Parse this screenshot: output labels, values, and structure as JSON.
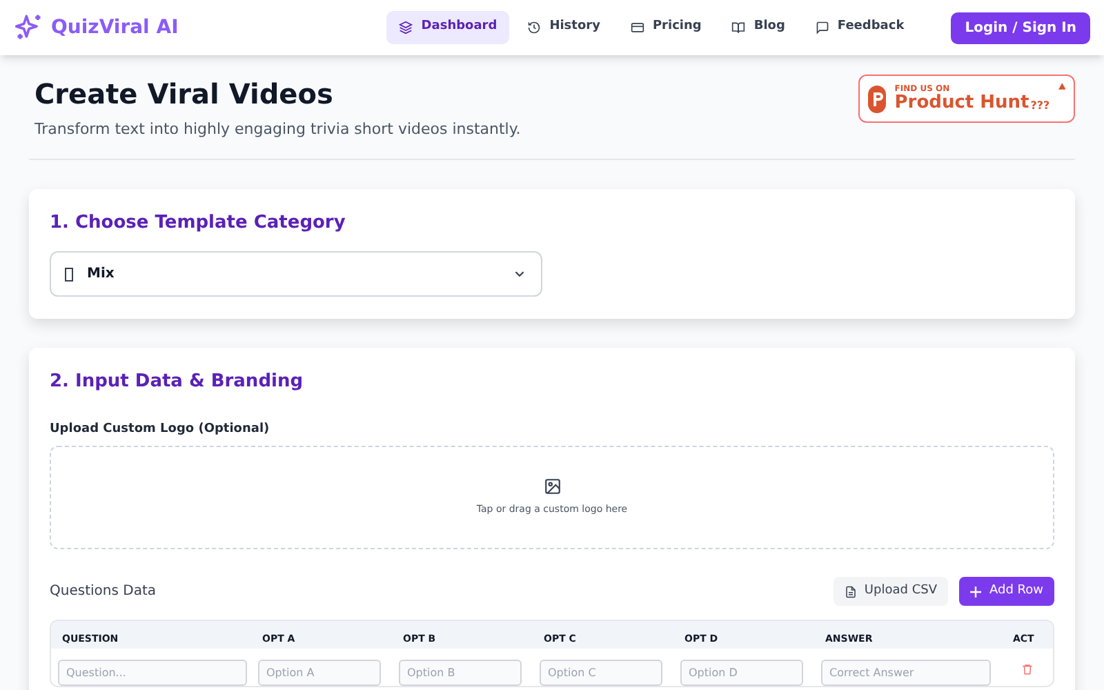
{
  "brand": {
    "name": "QuizViral AI"
  },
  "nav": [
    {
      "label": "Dashboard",
      "selected": true
    },
    {
      "label": "History",
      "selected": false
    },
    {
      "label": "Pricing",
      "selected": false
    },
    {
      "label": "Blog",
      "selected": false
    },
    {
      "label": "Feedback",
      "selected": false
    }
  ],
  "login_button": "Login / Sign In",
  "header": {
    "title": "Create Viral Videos",
    "subtitle": "Transform text into highly engaging trivia short videos instantly.",
    "badge": {
      "small": "FIND US ON",
      "big": "Product Hunt",
      "suffix": "???"
    }
  },
  "category_card": {
    "title": "1. Choose Template Category",
    "select_value": "Mix"
  },
  "input_card": {
    "title": "2. Input Data & Branding",
    "logo_label": "Upload Custom Logo (Optional)",
    "dropzone_hint": "Tap or drag a custom logo here",
    "questions_label": "Questions Data",
    "upload_csv": "Upload CSV",
    "add_row": "Add Row",
    "columns": [
      "QUESTION",
      "OPT A",
      "OPT B",
      "OPT C",
      "OPT D",
      "ANSWER",
      "ACT"
    ],
    "rows": [
      {
        "placeholders": [
          "Question...",
          "Option A",
          "Option B",
          "Option C",
          "Option D",
          "Correct Answer"
        ]
      }
    ]
  }
}
